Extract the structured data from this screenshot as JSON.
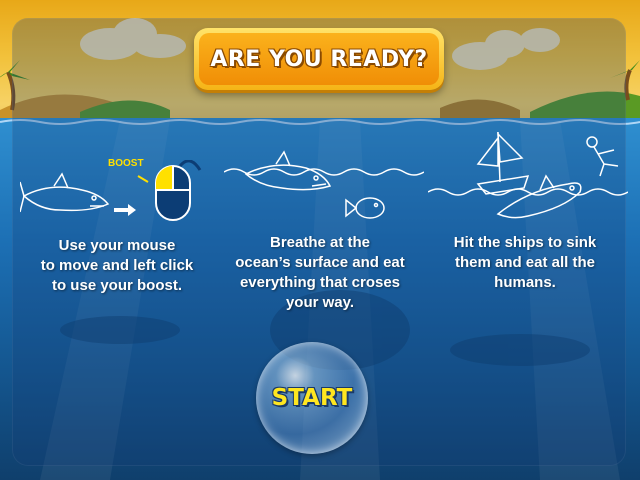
{
  "title": "ARE YOU READY?",
  "instructions": [
    {
      "text": "Use your mouse\nto move and left click\nto use your boost."
    },
    {
      "text": "Breathe at the\nocean’s surface and eat\neverything that croses\nyour way."
    },
    {
      "text": "Hit the ships to sink\nthem and eat all the\nhumans."
    }
  ],
  "boost_label": "BOOST",
  "start_label": "START",
  "colors": {
    "title_orange": "#f08e06",
    "title_yellow": "#ffe36a",
    "start_yellow": "#ffe620",
    "sea_blue": "#1c6fb4",
    "sky_gold": "#f2c23c"
  },
  "icons": [
    "shark-icon",
    "mouse-icon",
    "fish-icon",
    "ship-icon",
    "swimmer-icon",
    "arrow-icon"
  ]
}
